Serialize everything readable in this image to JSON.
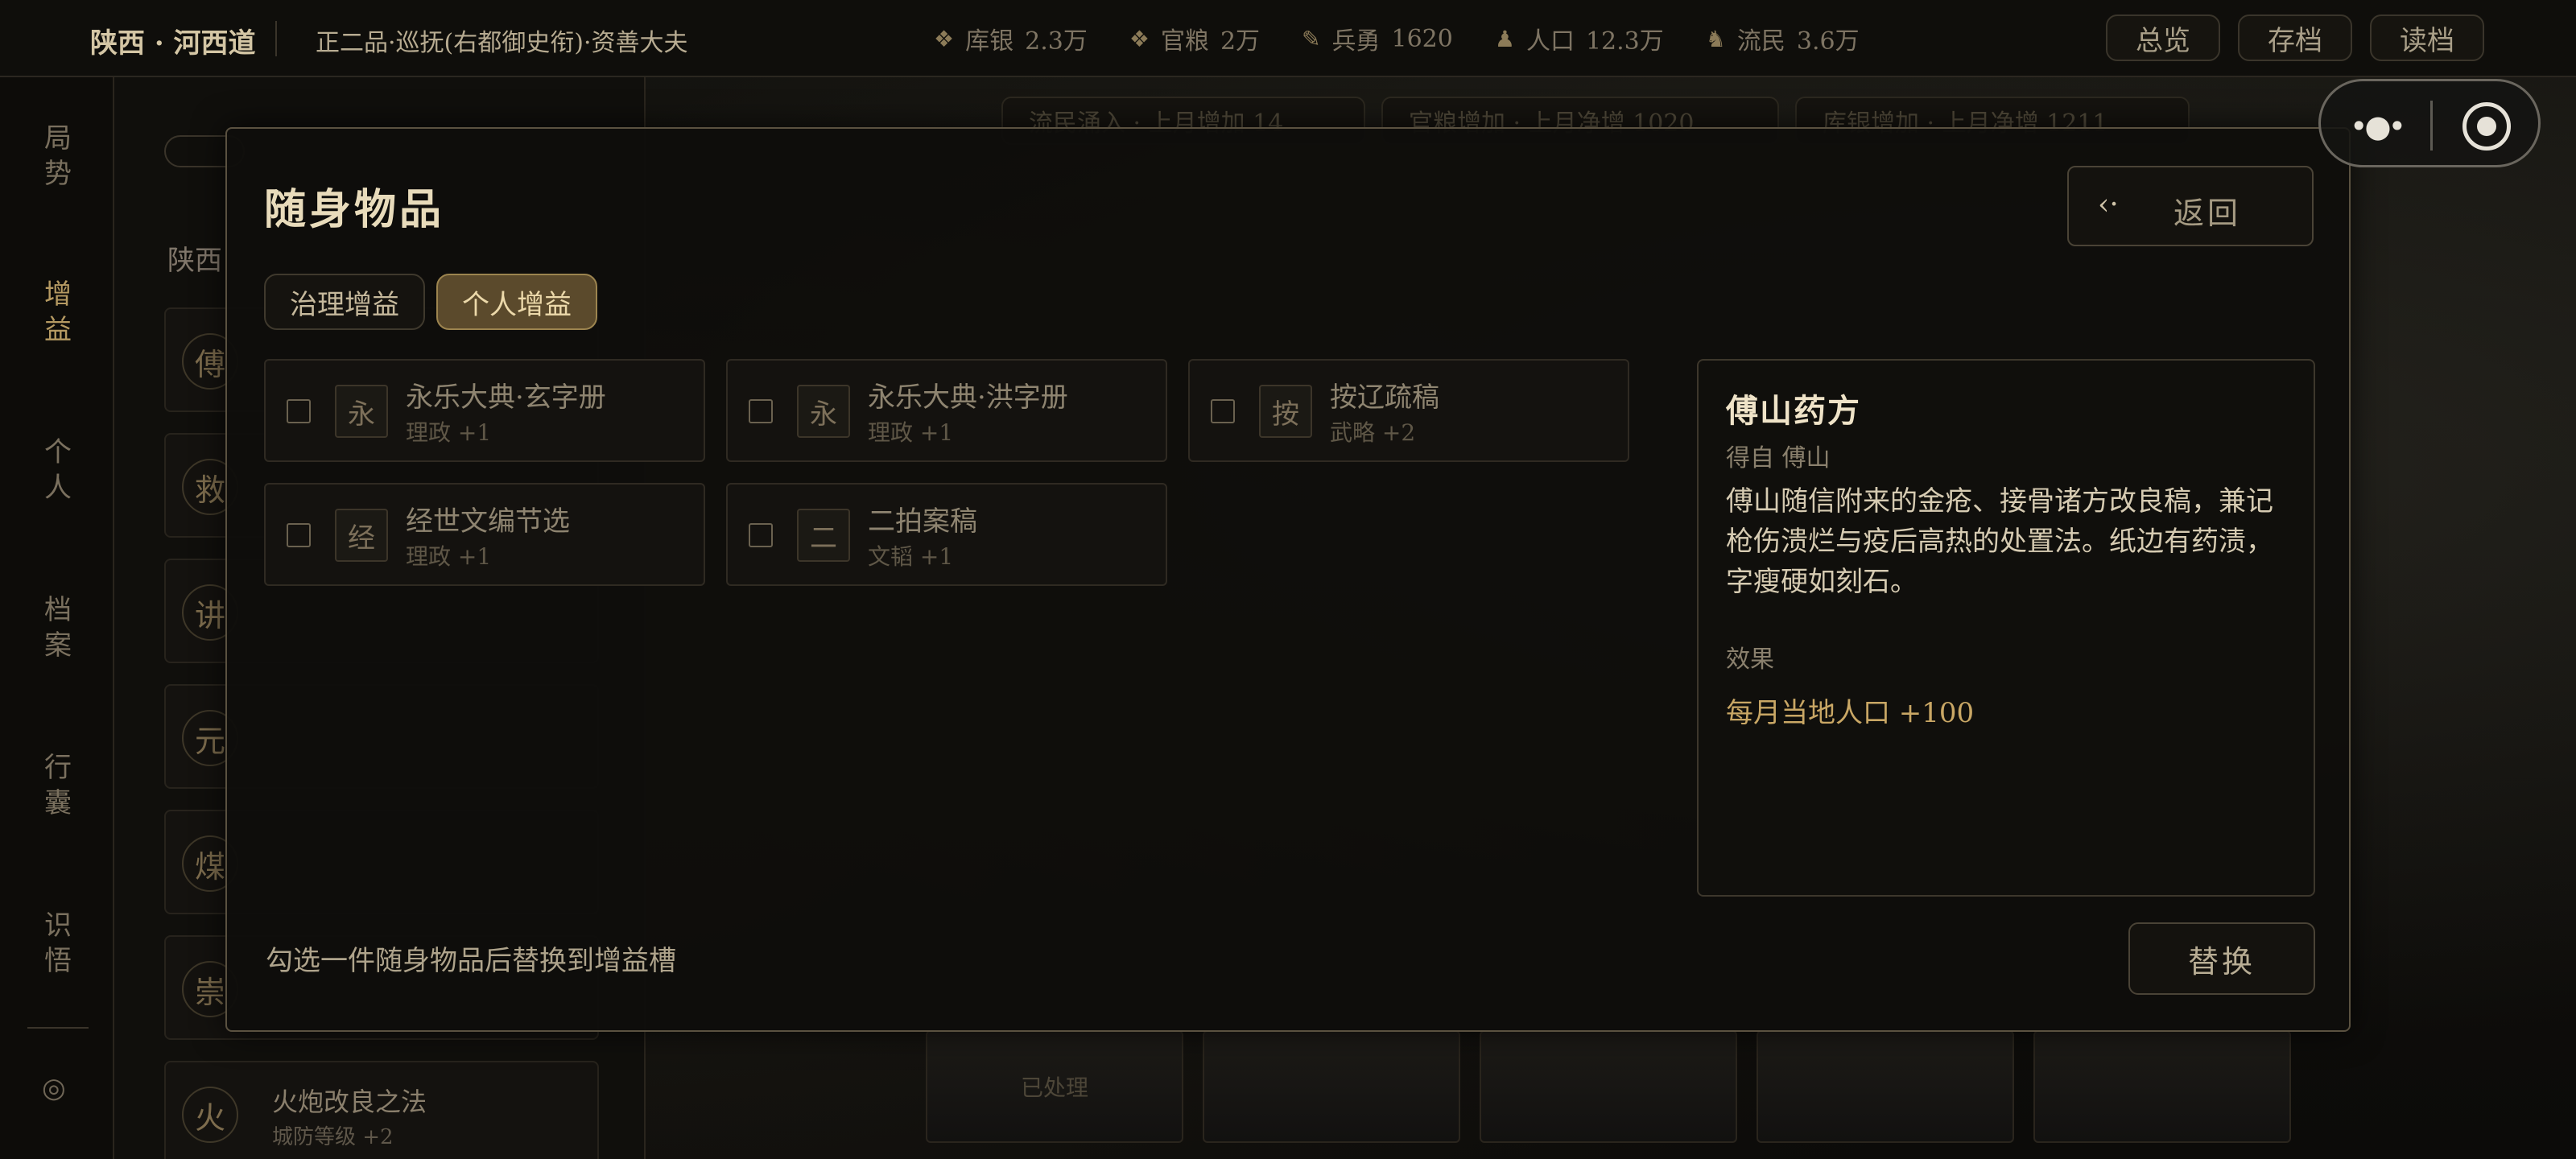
{
  "header": {
    "region": "陕西 · 河西道",
    "rank": "正二品·巡抚(右都御史衔)·资善大夫",
    "stats": [
      {
        "icon": "silver-coins-icon",
        "label": "库银",
        "value": "2.3万"
      },
      {
        "icon": "grain-sack-icon",
        "label": "官粮",
        "value": "2万"
      },
      {
        "icon": "soldier-spear-icon",
        "label": "兵勇",
        "value": "1620"
      },
      {
        "icon": "population-icon",
        "label": "人口",
        "value": "12.3万"
      },
      {
        "icon": "refugee-icon",
        "label": "流民",
        "value": "3.6万"
      }
    ],
    "buttons": {
      "overview": "总览",
      "save": "存档",
      "load": "读档"
    }
  },
  "rail": {
    "items": [
      {
        "label": "局势",
        "active": false
      },
      {
        "label": "增益",
        "active": true
      },
      {
        "label": "个人",
        "active": false
      },
      {
        "label": "档案",
        "active": false
      },
      {
        "label": "行囊",
        "active": false
      },
      {
        "label": "识悟",
        "active": false
      }
    ]
  },
  "background": {
    "list_title": "陕西",
    "list_glyphs": [
      "傅",
      "救",
      "讲",
      "元",
      "煤",
      "崇"
    ],
    "last_item": {
      "glyph": "火",
      "name": "火炮改良之法",
      "sub": "城防等级 +2"
    },
    "tabs": [
      "流民涌入 · 上月增加 14",
      "官粮增加 · 上月净增 1020",
      "库银增加 · 上月净增 1211"
    ],
    "processed_label": "已处理"
  },
  "modal": {
    "title": "随身物品",
    "back_label": "返回",
    "tabs": [
      {
        "label": "治理增益",
        "active": false
      },
      {
        "label": "个人增益",
        "active": true
      }
    ],
    "items": [
      {
        "glyph": "永",
        "name": "永乐大典·玄字册",
        "effect": "理政 +1"
      },
      {
        "glyph": "永",
        "name": "永乐大典·洪字册",
        "effect": "理政 +1"
      },
      {
        "glyph": "按",
        "name": "按辽疏稿",
        "effect": "武略 +2"
      },
      {
        "glyph": "经",
        "name": "经世文编节选",
        "effect": "理政 +1"
      },
      {
        "glyph": "二",
        "name": "二拍案稿",
        "effect": "文韬 +1"
      }
    ],
    "detail": {
      "name": "傅山药方",
      "source": "得自 傅山",
      "description": "傅山随信附来的金疮、接骨诸方改良稿，兼记枪伤溃烂与疫后高热的处置法。纸边有药渍，字瘦硬如刻石。",
      "effect_label": "效果",
      "effect": "每月当地人口 +100"
    },
    "hint": "勾选一件随身物品后替换到增益槽",
    "replace_label": "替换"
  },
  "colors": {
    "accent": "#c9a765",
    "active_tab": "#5b4a2c",
    "border": "#5a5140"
  }
}
